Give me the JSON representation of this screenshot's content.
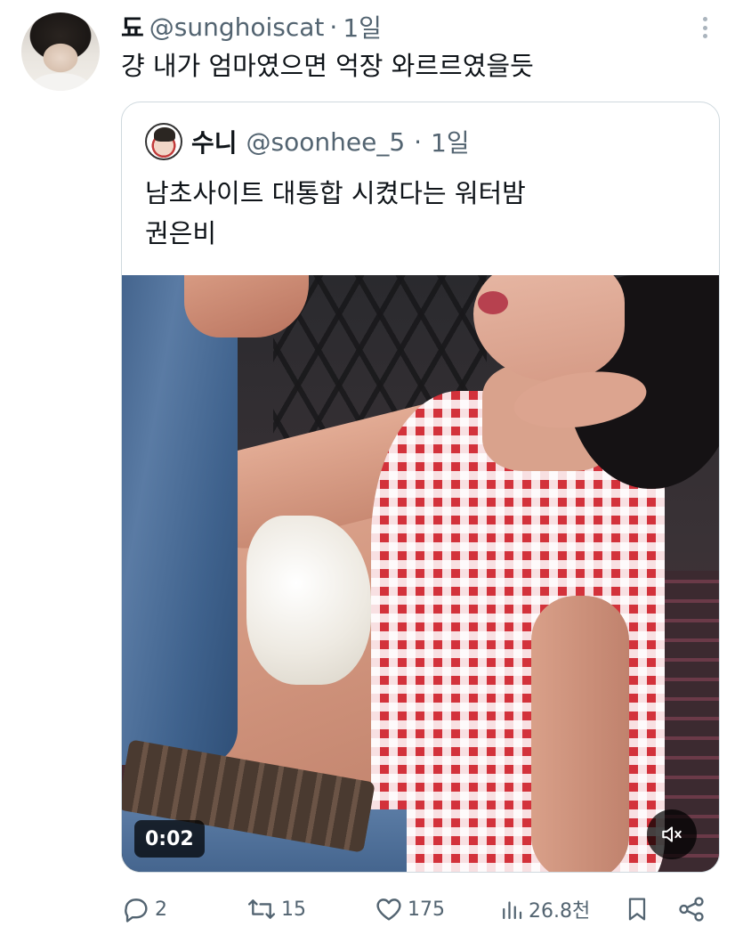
{
  "author": {
    "display_name": "됴",
    "handle": "@sunghoiscat",
    "separator": "·",
    "time": "1일",
    "text": "걍 내가 엄마였으면 억장 와르르였을듯"
  },
  "quoted": {
    "display_name": "수니",
    "handle": "@soonhee_5",
    "separator": "·",
    "time": "1일",
    "text_line1": "남초사이트 대통합 시켰다는 워터밤",
    "text_line2": "권은비",
    "video_time": "0:02",
    "mute_icon": "speaker-muted-icon"
  },
  "actions": {
    "replies": "2",
    "retweets": "15",
    "likes": "175",
    "views": "26.8천"
  },
  "colors": {
    "text": "#0f1419",
    "secondary": "#536471",
    "border": "#cfd9de"
  }
}
